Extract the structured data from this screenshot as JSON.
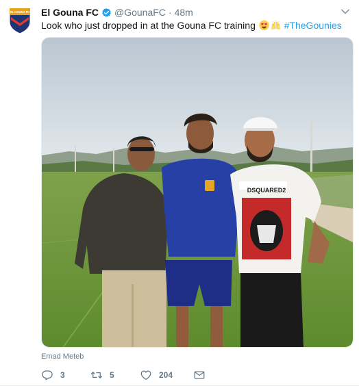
{
  "tweet": {
    "author_name": "El Gouna FC",
    "handle": "@GounaFC",
    "separator": "·",
    "time": "48m",
    "text_before": "Look who just dropped in at the Gouna FC training ",
    "hashtag": "#TheGounies",
    "media_credit": "Emad Meteb",
    "media_description": "Three men posing on a football training pitch on a sunny day",
    "jersey_text": "DSQUARED2"
  },
  "avatar": {
    "badge_text": "EL GOUNA FC",
    "colors": {
      "top": "#e8a418",
      "bottom": "#1e3473",
      "chevron": "#e03a2f"
    }
  },
  "actions": {
    "reply_count": "3",
    "retweet_count": "5",
    "like_count": "204"
  },
  "icons": {
    "verified": "verified-badge-icon",
    "caret": "chevron-down-icon",
    "reply": "reply-icon",
    "retweet": "retweet-icon",
    "like": "heart-icon",
    "dm": "envelope-icon",
    "emoji_1": "heart-eyes-emoji",
    "emoji_2": "raised-hands-emoji"
  },
  "colors": {
    "accent": "#1da1f2",
    "muted": "#657786",
    "text": "#14171a"
  }
}
